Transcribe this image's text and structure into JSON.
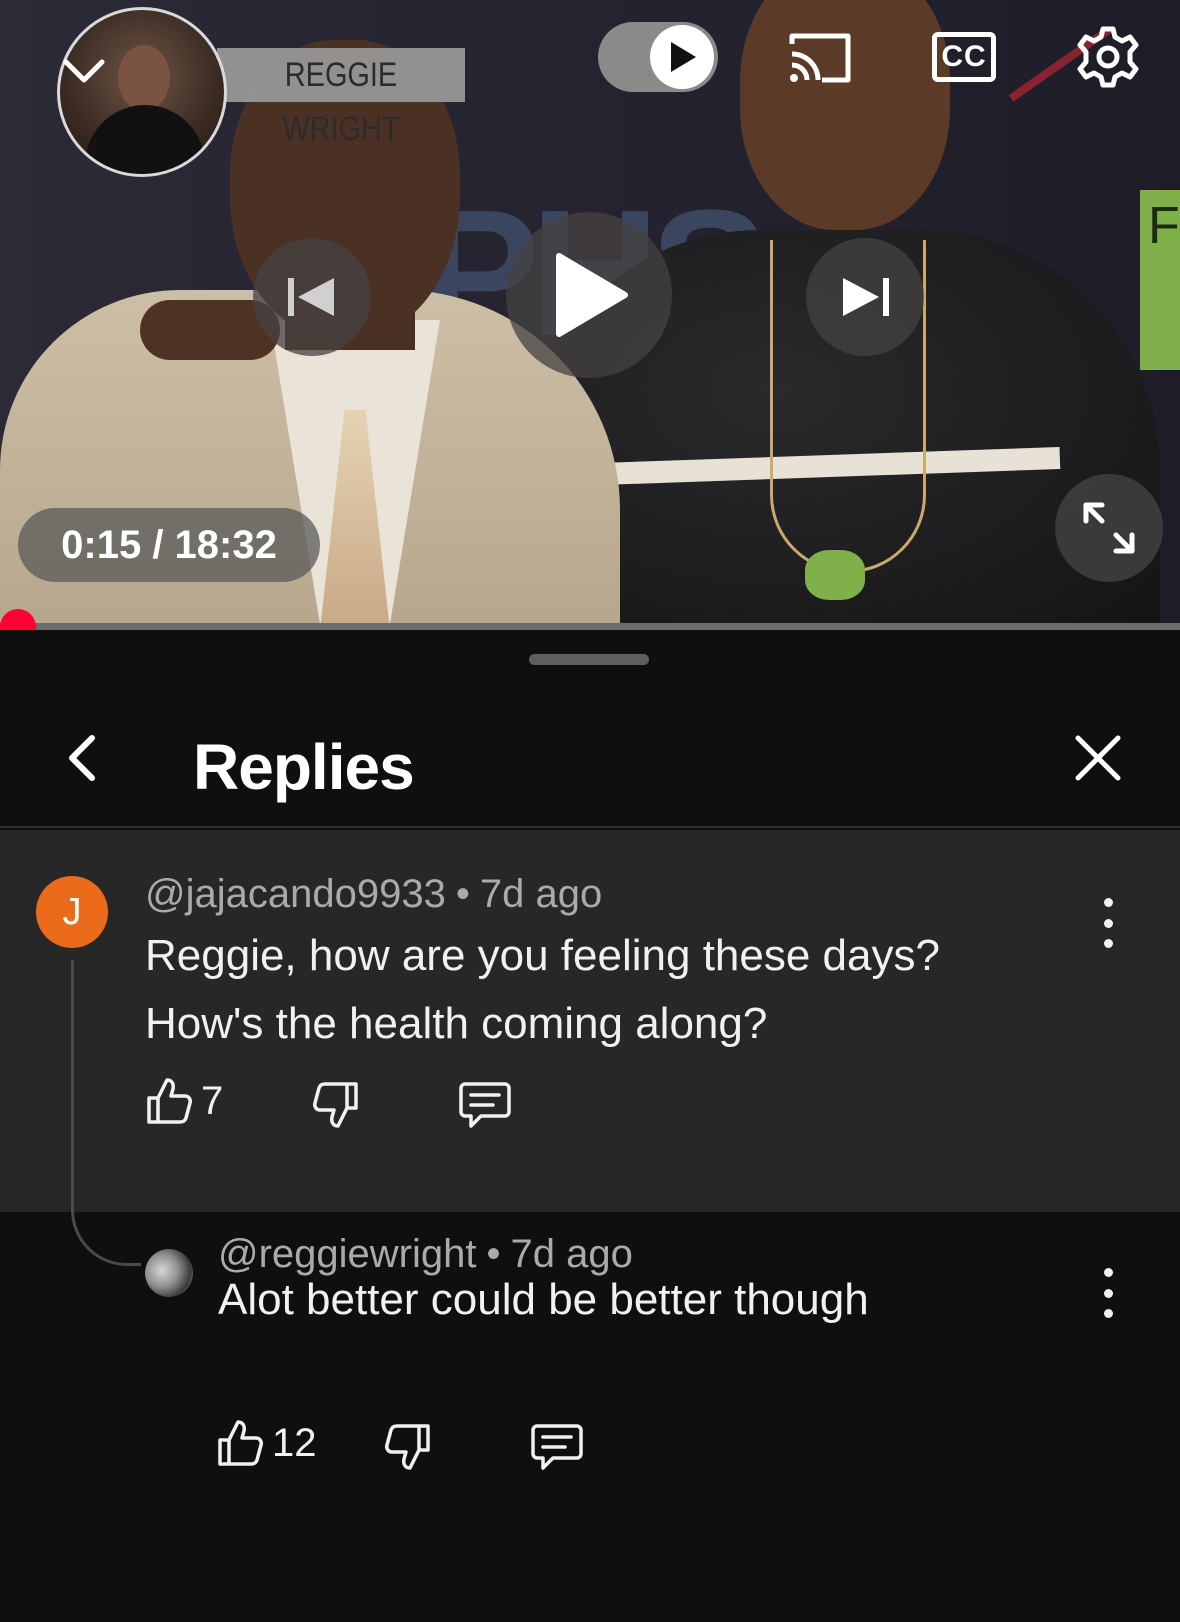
{
  "player": {
    "channel_overlay": "REGGIE WRIGHT",
    "time_display": "0:15 / 18:32",
    "progress_fraction": 0.014,
    "icons": [
      "chevron-down-icon",
      "autoplay-toggle-icon",
      "cast-icon",
      "captions-icon",
      "settings-icon",
      "previous-icon",
      "play-icon",
      "next-icon",
      "fullscreen-icon"
    ],
    "captions_label": "CC"
  },
  "sheet": {
    "title": "Replies"
  },
  "comments": [
    {
      "avatar_letter": "J",
      "avatar_color": "#ec6b1a",
      "handle": "@jajacando9933",
      "separator": "•",
      "age": "7d ago",
      "lines": [
        "Reggie, how are you feeling these days?",
        "How's the health coming along?"
      ],
      "likes": "7"
    },
    {
      "handle": "@reggiewright",
      "separator": "•",
      "age": "7d ago",
      "text": "Alot better could be better though",
      "likes": "12"
    }
  ],
  "colors": {
    "accent_red": "#ff0033",
    "sheet_bg": "#0f0f0f",
    "highlight_bg": "#272727"
  }
}
